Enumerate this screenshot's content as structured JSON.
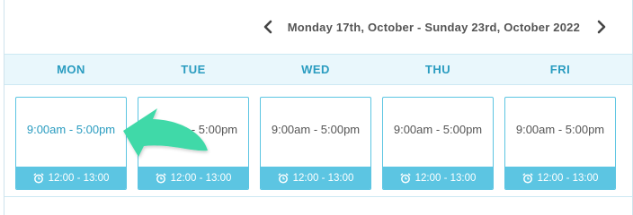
{
  "week": {
    "range_label": "Monday 17th, October - Sunday 23rd, October 2022",
    "prev_icon": "chevron-left-icon",
    "next_icon": "chevron-right-icon"
  },
  "days": [
    {
      "label": "MON",
      "hours": "9:00am - 5:00pm",
      "lunch": "12:00 - 13:00"
    },
    {
      "label": "TUE",
      "hours": "9:00am - 5:00pm",
      "lunch": "12:00 - 13:00"
    },
    {
      "label": "WED",
      "hours": "9:00am - 5:00pm",
      "lunch": "12:00 - 13:00"
    },
    {
      "label": "THU",
      "hours": "9:00am - 5:00pm",
      "lunch": "12:00 - 13:00"
    },
    {
      "label": "FRI",
      "hours": "9:00am - 5:00pm",
      "lunch": "12:00 - 13:00"
    }
  ],
  "lunch_icon": "alarm-clock-icon",
  "overlay_icon": "curved-arrow-icon",
  "colors": {
    "accent": "#2a9cc0",
    "card_border": "#5cc5e2",
    "header_bg": "#e9f7fc",
    "arrow": "#3fd9a8"
  }
}
